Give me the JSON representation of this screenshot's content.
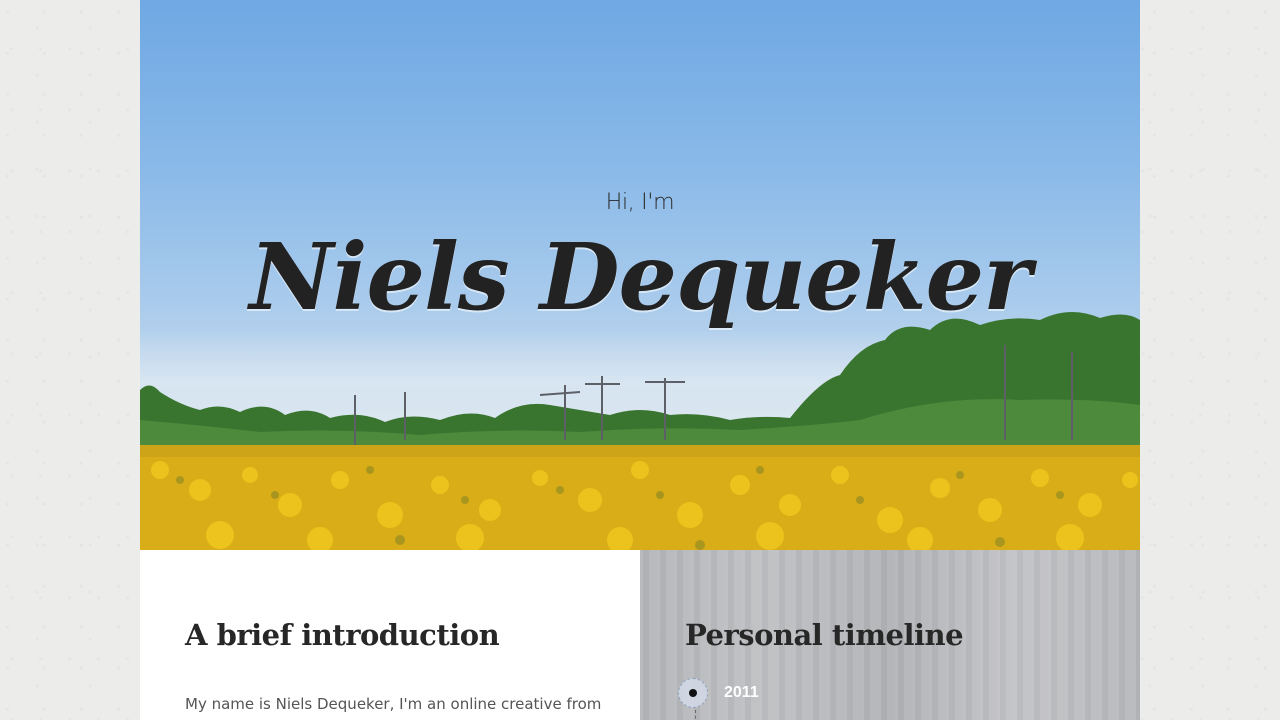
{
  "hero": {
    "greeting": "Hi, I'm",
    "name": "Niels Dequeker"
  },
  "intro": {
    "heading": "A brief introduction",
    "text": "My name is Niels Dequeker, I'm an online creative from"
  },
  "timeline": {
    "heading": "Personal timeline",
    "entries": [
      {
        "year": "2011"
      }
    ]
  },
  "colors": {
    "sky_top": "#6fa8e3",
    "sunflower": "#e2b714",
    "trees": "#3c7a33",
    "text_dark": "#222222",
    "timeline_year": "#ffffff"
  }
}
